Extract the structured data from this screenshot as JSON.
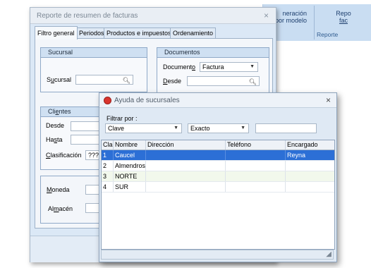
{
  "background_app": {
    "btn1_line1": "neración",
    "btn1_line2": "a por modelo",
    "btn2_line1": "Repo",
    "btn2_line2": "fac",
    "group_label": "Reporte"
  },
  "main_window": {
    "title": "Reporte de resumen de facturas",
    "close": "×",
    "tabs": [
      {
        "label": "Filtro general"
      },
      {
        "label": "Periodos"
      },
      {
        "label": "Productos e impuestos"
      },
      {
        "label": "Ordenamiento"
      }
    ],
    "sucursal": {
      "header": "Sucursal",
      "label_pre": "S",
      "label_u": "u",
      "label_post": "cursal",
      "value": ""
    },
    "documentos": {
      "header": "Documentos",
      "documento_pre": "Document",
      "documento_u": "o",
      "documento_value": "Factura",
      "desde_u": "D",
      "desde_post": "esde"
    },
    "clientes": {
      "header_pre": "Cli",
      "header_u": "e",
      "header_post": "ntes",
      "desde": "Desde",
      "hasta_pre": "Ha",
      "hasta_u": "s",
      "hasta_post": "ta",
      "clasificacion_u": "C",
      "clasificacion_post": "lasificación",
      "clasificacion_value": "????"
    },
    "moneda_u": "M",
    "moneda_post": "oneda",
    "almacen_pre": "Al",
    "almacen_u": "m",
    "almacen_post": "acén"
  },
  "dialog": {
    "title": "Ayuda de sucursales",
    "close": "×",
    "filter_label": "Filtrar por :",
    "filter_field": "Clave",
    "match_mode": "Exacto",
    "search_value": "",
    "columns": [
      "Cla",
      "Nombre",
      "Dirección",
      "Teléfono",
      "Encargado"
    ],
    "rows": [
      {
        "clave": "1",
        "nombre": "Caucel",
        "direccion": "",
        "telefono": "",
        "encargado": "Reyna"
      },
      {
        "clave": "2",
        "nombre": "Almendros",
        "direccion": "",
        "telefono": "",
        "encargado": ""
      },
      {
        "clave": "3",
        "nombre": "NORTE",
        "direccion": "",
        "telefono": "",
        "encargado": ""
      },
      {
        "clave": "4",
        "nombre": "SUR",
        "direccion": "",
        "telefono": "",
        "encargado": ""
      }
    ],
    "selected_row": 1
  },
  "icons": {
    "search": "magnifier-icon",
    "dropdown": "chevron-down-icon",
    "dialog_app": "app-icon",
    "resize": "resize-grip-icon"
  },
  "colors": {
    "selection": "#2c6fd6",
    "group_header": "#cfe0f2",
    "window_bg": "#dbe8f6",
    "alt_row": "#f2f8ec"
  }
}
